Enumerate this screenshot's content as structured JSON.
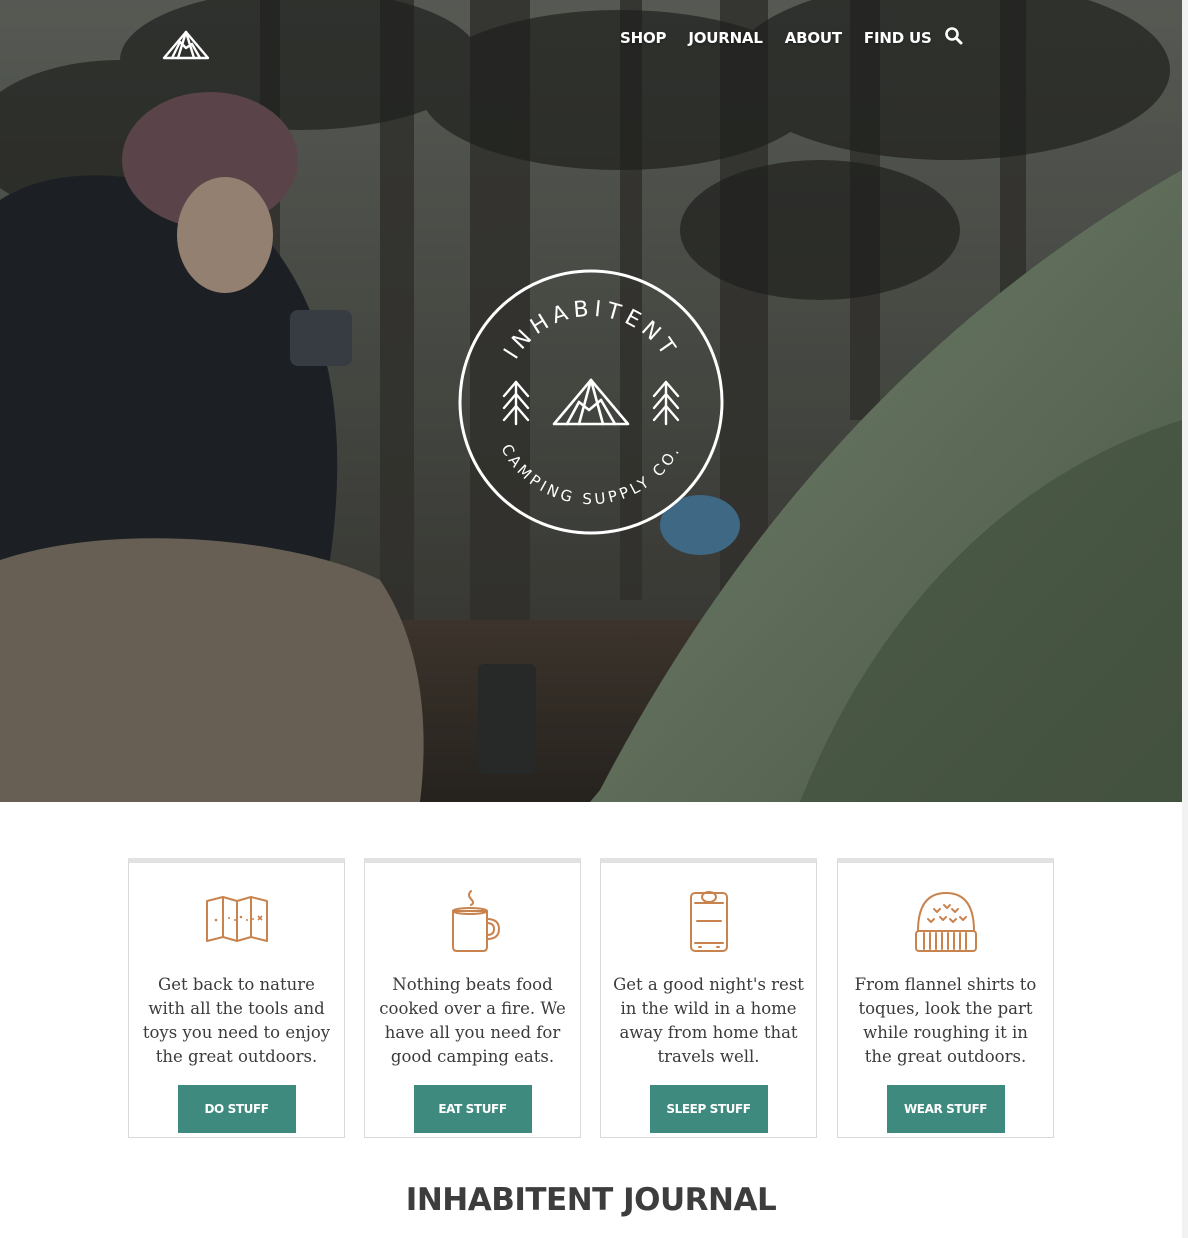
{
  "brand": {
    "name": "INHABITENT",
    "tagline": "CAMPING SUPPLY CO."
  },
  "nav": {
    "items": [
      {
        "label": "SHOP"
      },
      {
        "label": "JOURNAL"
      },
      {
        "label": "ABOUT"
      },
      {
        "label": "FIND US"
      }
    ],
    "search_icon": "search-icon"
  },
  "categories": [
    {
      "icon": "map-icon",
      "text": "Get back to nature with all the tools and toys you need to enjoy the great outdoors.",
      "button": "DO STUFF"
    },
    {
      "icon": "mug-icon",
      "text": "Nothing beats food cooked over a fire. We have all you need for good camping eats.",
      "button": "EAT STUFF"
    },
    {
      "icon": "sleeping-bag-icon",
      "text": "Get a good night's rest in the wild in a home away from home that travels well.",
      "button": "SLEEP STUFF"
    },
    {
      "icon": "toque-icon",
      "text": "From flannel shirts to toques, look the part while roughing it in the great outdoors.",
      "button": "WEAR STUFF"
    }
  ],
  "journal": {
    "title": "INHABITENT JOURNAL"
  },
  "colors": {
    "accent": "#3f8a7f",
    "icon": "#c9834e",
    "hero_overlay": "#2d2f2a"
  }
}
